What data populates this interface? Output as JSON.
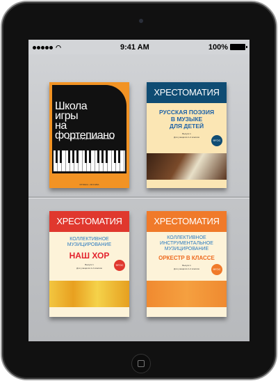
{
  "status_bar": {
    "time": "9:41 AM",
    "battery": "100%",
    "signal_dots": 5,
    "icons": [
      "signal-icon",
      "wifi-icon",
      "battery-icon"
    ]
  },
  "books": [
    {
      "title_lines": [
        "Школа",
        "игры",
        "на",
        "фортепиано"
      ],
      "editor": "под общей редакцией А. Николаева",
      "publisher": "МУЗЫКА • МОСКВА",
      "color": "#f29324"
    },
    {
      "series": "ХРЕСТОМАТИЯ",
      "title_lines": [
        "РУССКАЯ ПОЭЗИЯ",
        "В МУЗЫКЕ",
        "ДЛЯ ДЕТЕЙ"
      ],
      "issue": "Выпуск 1",
      "grade": "Для учащихся 1-2 классов",
      "badge": "ФГОС",
      "band_color": "#0f4c73"
    },
    {
      "series": "ХРЕСТОМАТИЯ",
      "subtitle_lines": [
        "КОЛЛЕКТИВНОЕ",
        "МУЗИЦИРОВАНИЕ"
      ],
      "title": "НАШ ХОР",
      "issue": "Выпуск 1",
      "grade": "Для учащихся 1-2 классов",
      "badge": "ФГОС",
      "band_color": "#e0382e"
    },
    {
      "series": "ХРЕСТОМАТИЯ",
      "subtitle_lines": [
        "КОЛЛЕКТИВНОЕ",
        "ИНСТРУМЕНТАЛЬНОЕ",
        "МУЗИЦИРОВАНИЕ"
      ],
      "title": "ОРКЕСТР В КЛАССЕ",
      "issue": "Выпуск 1",
      "grade": "Для учащихся 1-2 классов",
      "badge": "ФГОС",
      "band_color": "#f07a2a"
    }
  ]
}
